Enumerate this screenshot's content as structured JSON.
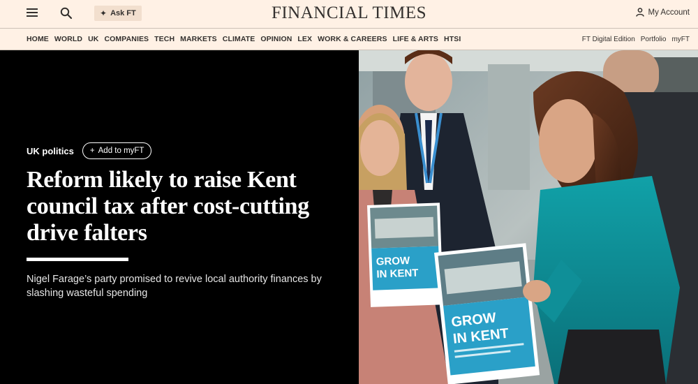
{
  "header": {
    "masthead": "FINANCIAL TIMES",
    "ask_ft_label": "Ask FT",
    "account_label": "My Account"
  },
  "nav": {
    "left": [
      "HOME",
      "WORLD",
      "UK",
      "COMPANIES",
      "TECH",
      "MARKETS",
      "CLIMATE",
      "OPINION",
      "LEX",
      "WORK & CAREERS",
      "LIFE & ARTS",
      "HTSI"
    ],
    "right": [
      "FT Digital Edition",
      "Portfolio",
      "myFT"
    ]
  },
  "article": {
    "topic": "UK politics",
    "add_to_myft": "Add to myFT",
    "headline_lines": [
      "Reform likely to raise Kent",
      "council tax after cost-cutting",
      "drive falters"
    ],
    "standfirst_lines": [
      "Nigel Farage’s party promised to revive local authority finances by",
      "slashing wasteful spending"
    ]
  },
  "photo": {
    "sign_small": [
      "GROW",
      "IN KENT"
    ],
    "sign_large": [
      "GROW",
      "IN KENT"
    ],
    "colors": {
      "background": "#000000",
      "page": "#fff1e5",
      "teal_top": "#0d8a96",
      "sign_blue": "#2aa0c8"
    }
  }
}
